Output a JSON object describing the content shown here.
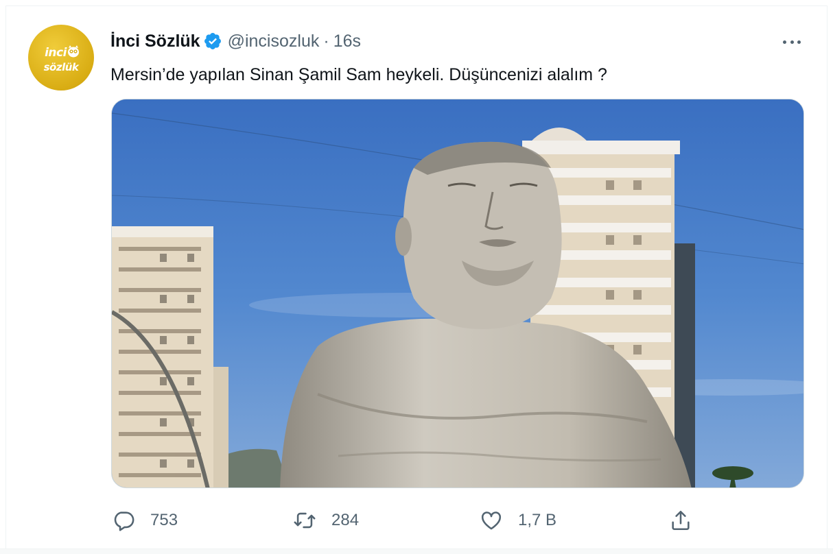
{
  "tweet": {
    "display_name": "İnci Sözlük",
    "handle": "@incisozluk",
    "separator": "·",
    "time": "16s",
    "text": "Mersin’de yapılan Sinan Şamil Sam heykeli. Düşüncenizi alalım ?",
    "avatar": {
      "line1": "inci",
      "line2": "sözlük",
      "color": "#d9ad14"
    },
    "verified_color": "#1d9bf0",
    "image_alt": "photo"
  },
  "actions": {
    "reply_count": "753",
    "retweet_count": "284",
    "like_count": "1,7 B",
    "icons": [
      "reply-icon",
      "retweet-icon",
      "like-icon",
      "share-icon"
    ]
  },
  "colors": {
    "text": "#0f1419",
    "secondary": "#536471",
    "sky": "#4f86cf"
  }
}
